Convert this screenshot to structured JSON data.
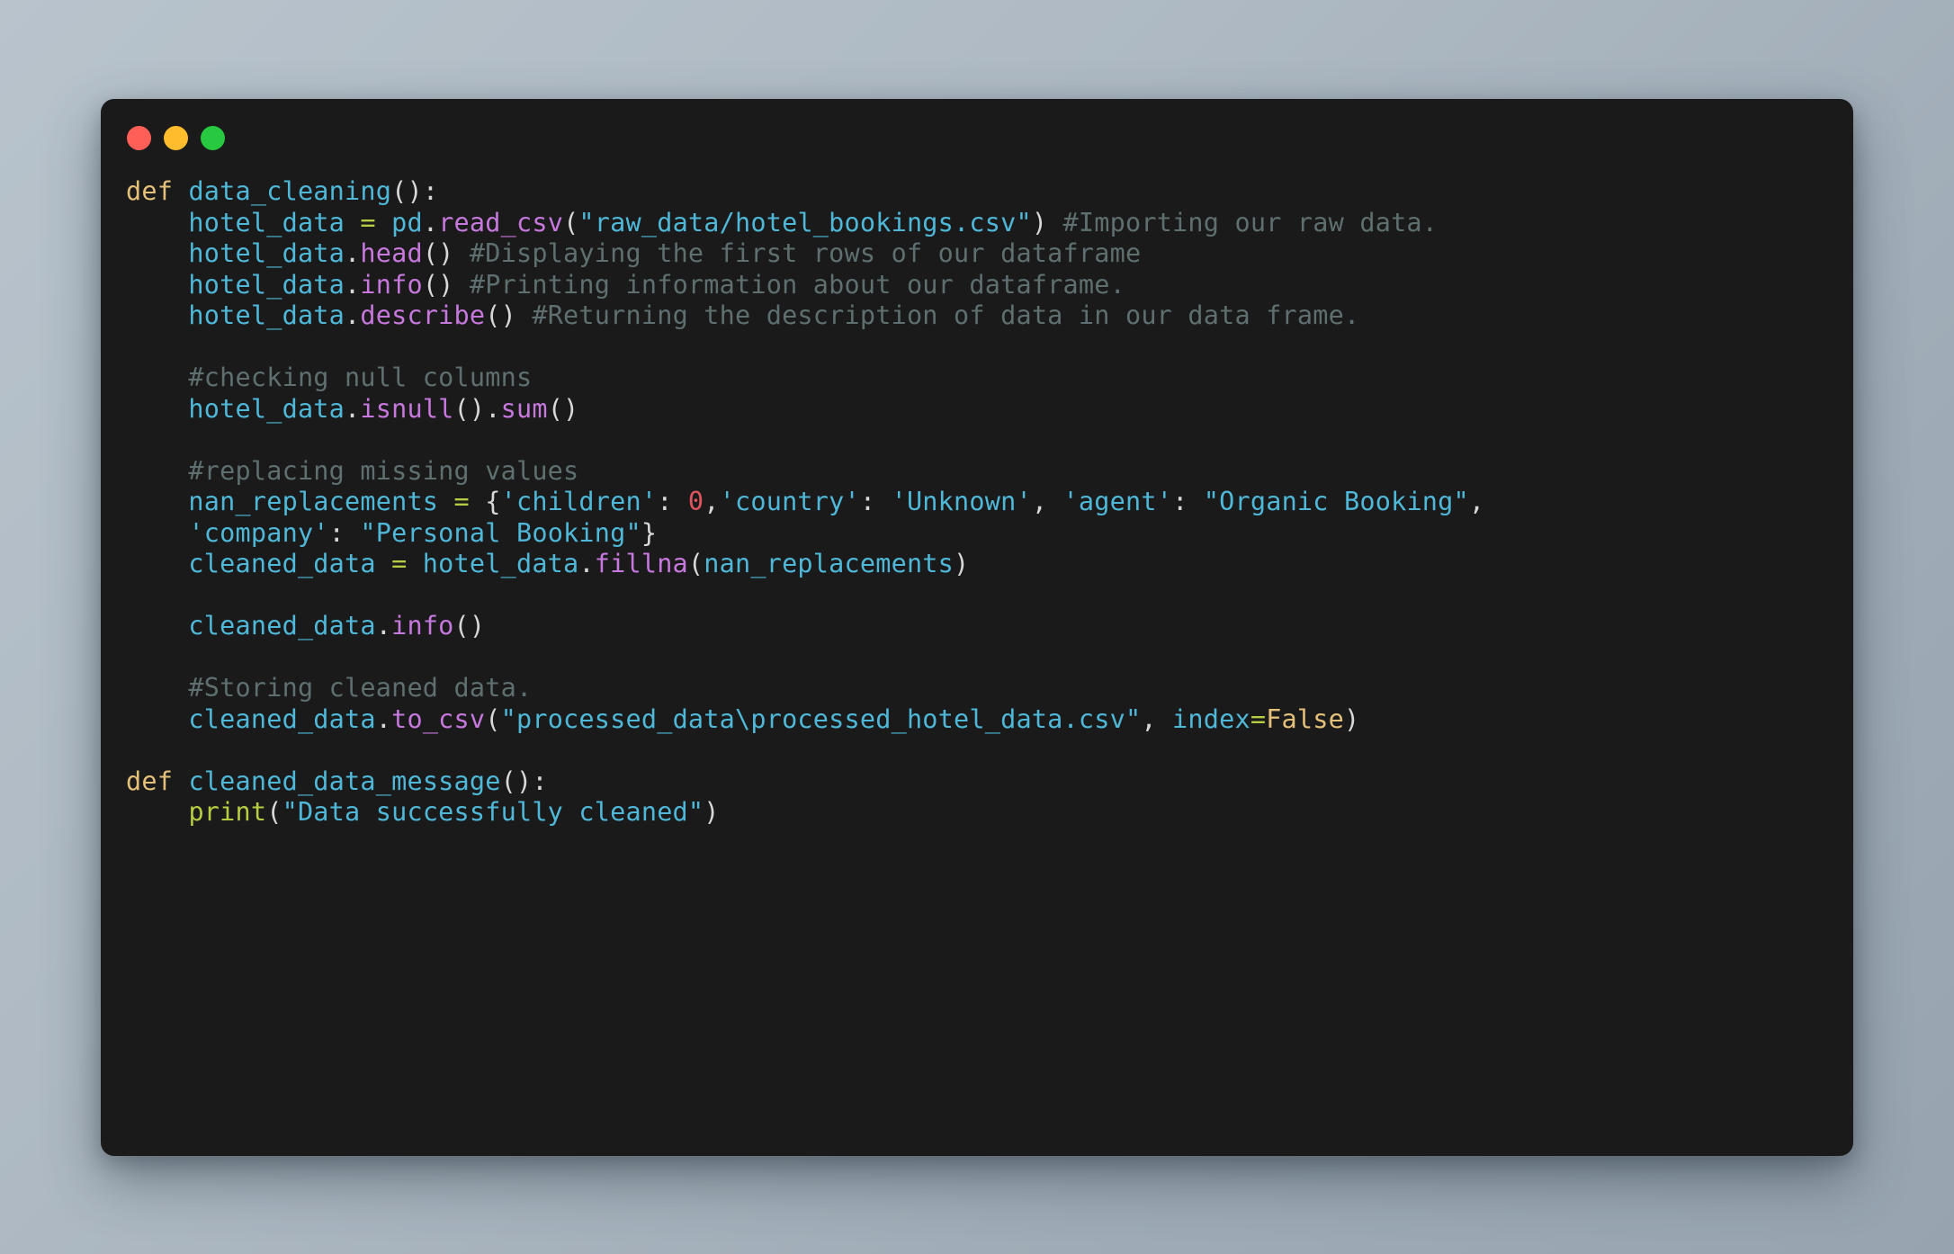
{
  "window": {
    "name": "code-snippet-window",
    "traffic_lights": [
      {
        "name": "close-button",
        "color": "#ff5f57"
      },
      {
        "name": "minimize-button",
        "color": "#ffbd2e"
      },
      {
        "name": "maximize-button",
        "color": "#28c840"
      }
    ]
  },
  "theme": {
    "desktop_background_from": "#b8c3cc",
    "desktop_background_to": "#97a4b0",
    "editor_background": "#1a1a1a",
    "keyword": "#e5c07b",
    "identifier": "#4fb8d8",
    "string": "#4fb8d8",
    "method": "#c678dd",
    "operator": "#b5cc43",
    "number": "#e0555f",
    "comment": "#5f6f6f",
    "punctuation": "#d8d8d8",
    "builtin_function": "#b5cc43"
  },
  "code": {
    "language": "python",
    "plain_text": "def data_cleaning():\n    hotel_data = pd.read_csv(\"raw_data/hotel_bookings.csv\") #Importing our raw data.\n    hotel_data.head() #Displaying the first rows of our dataframe\n    hotel_data.info() #Printing information about our dataframe.\n    hotel_data.describe() #Returning the description of data in our data frame.\n\n    #checking null columns\n    hotel_data.isnull().sum()\n\n    #replacing missing values\n    nan_replacements = {'children': 0,'country': 'Unknown', 'agent': \"Organic Booking\",\n    'company': \"Personal Booking\"}\n    cleaned_data = hotel_data.fillna(nan_replacements)\n\n    cleaned_data.info()\n\n    #Storing cleaned data.\n    cleaned_data.to_csv(\"processed_data\\processed_hotel_data.csv\", index=False)\n\ndef cleaned_data_message():\n    print(\"Data successfully cleaned\")",
    "lines": [
      {
        "n": 1,
        "tokens": [
          {
            "t": "def ",
            "k": "kw"
          },
          {
            "t": "data_cleaning",
            "k": "name"
          },
          {
            "t": "():",
            "k": "punct"
          }
        ]
      },
      {
        "n": 2,
        "tokens": [
          {
            "t": "    hotel_data ",
            "k": "name"
          },
          {
            "t": "=",
            "k": "op"
          },
          {
            "t": " pd",
            "k": "name"
          },
          {
            "t": ".",
            "k": "punct"
          },
          {
            "t": "read_csv",
            "k": "method"
          },
          {
            "t": "(",
            "k": "punct"
          },
          {
            "t": "\"raw_data/hotel_bookings.csv\"",
            "k": "str"
          },
          {
            "t": ") ",
            "k": "punct"
          },
          {
            "t": "#Importing our raw data.",
            "k": "comment"
          }
        ]
      },
      {
        "n": 3,
        "tokens": [
          {
            "t": "    hotel_data",
            "k": "name"
          },
          {
            "t": ".",
            "k": "punct"
          },
          {
            "t": "head",
            "k": "method"
          },
          {
            "t": "() ",
            "k": "punct"
          },
          {
            "t": "#Displaying the first rows of our dataframe",
            "k": "comment"
          }
        ]
      },
      {
        "n": 4,
        "tokens": [
          {
            "t": "    hotel_data",
            "k": "name"
          },
          {
            "t": ".",
            "k": "punct"
          },
          {
            "t": "info",
            "k": "method"
          },
          {
            "t": "() ",
            "k": "punct"
          },
          {
            "t": "#Printing information about our dataframe.",
            "k": "comment"
          }
        ]
      },
      {
        "n": 5,
        "tokens": [
          {
            "t": "    hotel_data",
            "k": "name"
          },
          {
            "t": ".",
            "k": "punct"
          },
          {
            "t": "describe",
            "k": "method"
          },
          {
            "t": "() ",
            "k": "punct"
          },
          {
            "t": "#Returning the description of data in our data frame.",
            "k": "comment"
          }
        ]
      },
      {
        "n": 6,
        "tokens": []
      },
      {
        "n": 7,
        "tokens": [
          {
            "t": "    #checking null columns",
            "k": "comment"
          }
        ]
      },
      {
        "n": 8,
        "tokens": [
          {
            "t": "    hotel_data",
            "k": "name"
          },
          {
            "t": ".",
            "k": "punct"
          },
          {
            "t": "isnull",
            "k": "method"
          },
          {
            "t": "()",
            "k": "punct"
          },
          {
            "t": ".",
            "k": "punct"
          },
          {
            "t": "sum",
            "k": "method"
          },
          {
            "t": "()",
            "k": "punct"
          }
        ]
      },
      {
        "n": 9,
        "tokens": []
      },
      {
        "n": 10,
        "tokens": [
          {
            "t": "    #replacing missing values",
            "k": "comment"
          }
        ]
      },
      {
        "n": 11,
        "tokens": [
          {
            "t": "    nan_replacements ",
            "k": "name"
          },
          {
            "t": "=",
            "k": "op"
          },
          {
            "t": " {",
            "k": "punct"
          },
          {
            "t": "'children'",
            "k": "str"
          },
          {
            "t": ": ",
            "k": "punct"
          },
          {
            "t": "0",
            "k": "num"
          },
          {
            "t": ",",
            "k": "punct"
          },
          {
            "t": "'country'",
            "k": "str"
          },
          {
            "t": ": ",
            "k": "punct"
          },
          {
            "t": "'Unknown'",
            "k": "str"
          },
          {
            "t": ", ",
            "k": "punct"
          },
          {
            "t": "'agent'",
            "k": "str"
          },
          {
            "t": ": ",
            "k": "punct"
          },
          {
            "t": "\"Organic Booking\"",
            "k": "str"
          },
          {
            "t": ",",
            "k": "punct"
          }
        ]
      },
      {
        "n": 12,
        "tokens": [
          {
            "t": "    ",
            "k": "punct"
          },
          {
            "t": "'company'",
            "k": "str"
          },
          {
            "t": ": ",
            "k": "punct"
          },
          {
            "t": "\"Personal Booking\"",
            "k": "str"
          },
          {
            "t": "}",
            "k": "punct"
          }
        ]
      },
      {
        "n": 13,
        "tokens": [
          {
            "t": "    cleaned_data ",
            "k": "name"
          },
          {
            "t": "=",
            "k": "op"
          },
          {
            "t": " hotel_data",
            "k": "name"
          },
          {
            "t": ".",
            "k": "punct"
          },
          {
            "t": "fillna",
            "k": "method"
          },
          {
            "t": "(",
            "k": "punct"
          },
          {
            "t": "nan_replacements",
            "k": "name"
          },
          {
            "t": ")",
            "k": "punct"
          }
        ]
      },
      {
        "n": 14,
        "tokens": []
      },
      {
        "n": 15,
        "tokens": [
          {
            "t": "    cleaned_data",
            "k": "name"
          },
          {
            "t": ".",
            "k": "punct"
          },
          {
            "t": "info",
            "k": "method"
          },
          {
            "t": "()",
            "k": "punct"
          }
        ]
      },
      {
        "n": 16,
        "tokens": []
      },
      {
        "n": 17,
        "tokens": [
          {
            "t": "    #Storing cleaned data.",
            "k": "comment"
          }
        ]
      },
      {
        "n": 18,
        "tokens": [
          {
            "t": "    cleaned_data",
            "k": "name"
          },
          {
            "t": ".",
            "k": "punct"
          },
          {
            "t": "to_csv",
            "k": "method"
          },
          {
            "t": "(",
            "k": "punct"
          },
          {
            "t": "\"processed_data\\processed_hotel_data.csv\"",
            "k": "str"
          },
          {
            "t": ", ",
            "k": "punct"
          },
          {
            "t": "index",
            "k": "name"
          },
          {
            "t": "=",
            "k": "op"
          },
          {
            "t": "False",
            "k": "kw"
          },
          {
            "t": ")",
            "k": "punct"
          }
        ]
      },
      {
        "n": 19,
        "tokens": []
      },
      {
        "n": 20,
        "tokens": [
          {
            "t": "def ",
            "k": "kw"
          },
          {
            "t": "cleaned_data_message",
            "k": "name"
          },
          {
            "t": "():",
            "k": "punct"
          }
        ]
      },
      {
        "n": 21,
        "tokens": [
          {
            "t": "    ",
            "k": "punct"
          },
          {
            "t": "print",
            "k": "fn"
          },
          {
            "t": "(",
            "k": "punct"
          },
          {
            "t": "\"Data successfully cleaned\"",
            "k": "str"
          },
          {
            "t": ")",
            "k": "punct"
          }
        ]
      }
    ]
  }
}
